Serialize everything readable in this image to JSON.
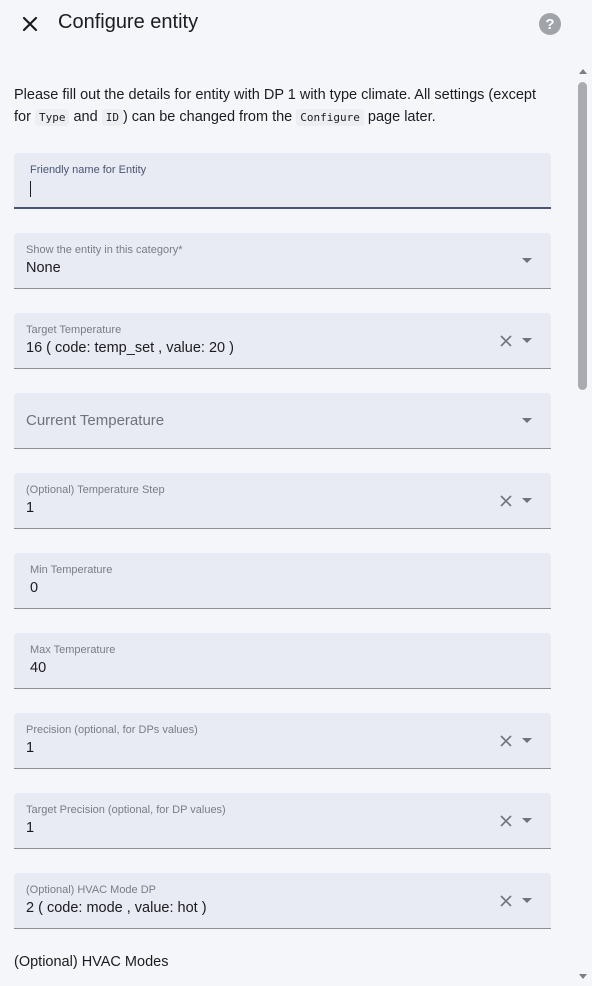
{
  "header": {
    "title": "Configure entity",
    "help_label": "?"
  },
  "description": {
    "part1": "Please fill out the details for entity with DP 1 with type climate. All settings (except for ",
    "code_type": "Type",
    "and_text": " and ",
    "code_id": "ID",
    "part2": ") can be changed from the ",
    "code_configure": "Configure",
    "part3": " page later."
  },
  "fields": {
    "friendly_name": {
      "label": "Friendly name for Entity",
      "value": ""
    },
    "category": {
      "label": "Show the entity in this category*",
      "value": "None"
    },
    "target_temperature": {
      "label": "Target Temperature",
      "value": "16 ( code: temp_set , value: 20 )"
    },
    "current_temperature": {
      "placeholder": "Current Temperature"
    },
    "temperature_step": {
      "label": "(Optional) Temperature Step",
      "value": "1"
    },
    "min_temperature": {
      "label": "Min Temperature",
      "value": "0"
    },
    "max_temperature": {
      "label": "Max Temperature",
      "value": "40"
    },
    "precision": {
      "label": "Precision (optional, for DPs values)",
      "value": "1"
    },
    "target_precision": {
      "label": "Target Precision (optional, for DP values)",
      "value": "1"
    },
    "hvac_mode_dp": {
      "label": "(Optional) HVAC Mode DP",
      "value": "2 ( code: mode , value: hot )"
    }
  },
  "hvac_modes_label": "(Optional) HVAC Modes",
  "scrollbar": {
    "position_fraction": 0.0
  }
}
